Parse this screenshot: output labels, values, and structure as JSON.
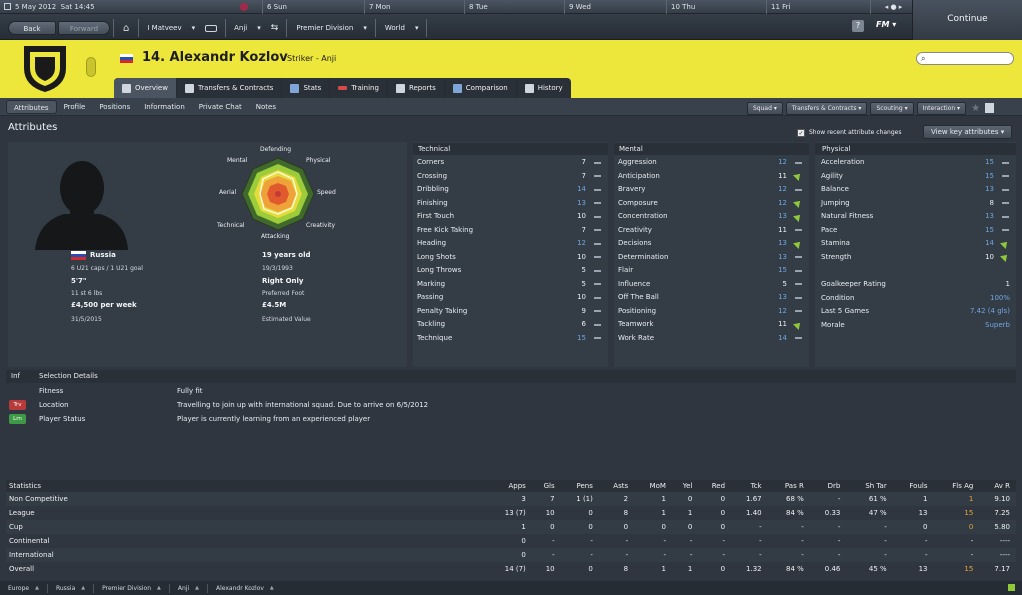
{
  "topbar": {
    "date": "5 May 2012",
    "time": "Sat 14:45",
    "calendar_days": [
      "6 Sun",
      "7 Mon",
      "8 Tue",
      "9 Wed",
      "10 Thu",
      "11 Fri"
    ],
    "back": "Back",
    "forward": "Forward",
    "manager": "I Matveev",
    "club": "Anji",
    "league": "Premier Division",
    "world": "World",
    "help": "?",
    "fm": "FM",
    "continue": "Continue"
  },
  "header": {
    "player_title": "14. Alexandr Kozlov",
    "player_sub": "Striker - Anji",
    "brand_color": "#ece73a",
    "tabs": [
      "Overview",
      "Transfers & Contracts",
      "Stats",
      "Training",
      "Reports",
      "Comparison",
      "History"
    ]
  },
  "subnav": {
    "links": [
      "Attributes",
      "Profile",
      "Positions",
      "Information",
      "Private Chat",
      "Notes"
    ],
    "dropdowns": [
      "Squad",
      "Transfers & Contracts",
      "Scouting",
      "Interaction"
    ]
  },
  "attributes": {
    "heading": "Attributes",
    "show_recent": "Show recent attribute changes",
    "view_key": "View key attributes"
  },
  "profile": {
    "nation": "Russia",
    "caps": "6 U21 caps / 1 U21 goal",
    "height": "5'7\"",
    "weight": "11 st 6 lbs",
    "wage": "£4,500 per week",
    "contract": "31/5/2015",
    "age": "19 years old",
    "dob": "19/3/1993",
    "foot": "Right Only",
    "foot_label": "Preferred Foot",
    "value": "£4.5M",
    "value_label": "Estimated Value"
  },
  "radar": {
    "labels": [
      "Defending",
      "Physical",
      "Speed",
      "Creativity",
      "Attacking",
      "Technical",
      "Aerial",
      "Mental"
    ]
  },
  "technical": {
    "title": "Technical",
    "items": [
      {
        "name": "Corners",
        "val": "7",
        "trend": "dash",
        "hi": false
      },
      {
        "name": "Crossing",
        "val": "7",
        "trend": "dash",
        "hi": false
      },
      {
        "name": "Dribbling",
        "val": "14",
        "trend": "dash",
        "hi": true
      },
      {
        "name": "Finishing",
        "val": "13",
        "trend": "dash",
        "hi": true
      },
      {
        "name": "First Touch",
        "val": "10",
        "trend": "dash",
        "hi": false
      },
      {
        "name": "Free Kick Taking",
        "val": "7",
        "trend": "dash",
        "hi": false
      },
      {
        "name": "Heading",
        "val": "12",
        "trend": "dash",
        "hi": true
      },
      {
        "name": "Long Shots",
        "val": "10",
        "trend": "dash",
        "hi": false
      },
      {
        "name": "Long Throws",
        "val": "5",
        "trend": "dash",
        "hi": false
      },
      {
        "name": "Marking",
        "val": "5",
        "trend": "dash",
        "hi": false
      },
      {
        "name": "Passing",
        "val": "10",
        "trend": "dash",
        "hi": false
      },
      {
        "name": "Penalty Taking",
        "val": "9",
        "trend": "dash",
        "hi": false
      },
      {
        "name": "Tackling",
        "val": "6",
        "trend": "dash",
        "hi": false
      },
      {
        "name": "Technique",
        "val": "15",
        "trend": "dash",
        "hi": true
      }
    ]
  },
  "mental": {
    "title": "Mental",
    "items": [
      {
        "name": "Aggression",
        "val": "12",
        "trend": "dash",
        "hi": true
      },
      {
        "name": "Anticipation",
        "val": "11",
        "trend": "up",
        "hi": false
      },
      {
        "name": "Bravery",
        "val": "12",
        "trend": "dash",
        "hi": true
      },
      {
        "name": "Composure",
        "val": "12",
        "trend": "up",
        "hi": true
      },
      {
        "name": "Concentration",
        "val": "13",
        "trend": "up",
        "hi": true
      },
      {
        "name": "Creativity",
        "val": "11",
        "trend": "dash",
        "hi": false
      },
      {
        "name": "Decisions",
        "val": "13",
        "trend": "up",
        "hi": true
      },
      {
        "name": "Determination",
        "val": "13",
        "trend": "dash",
        "hi": true
      },
      {
        "name": "Flair",
        "val": "15",
        "trend": "dash",
        "hi": true
      },
      {
        "name": "Influence",
        "val": "5",
        "trend": "dash",
        "hi": false
      },
      {
        "name": "Off The Ball",
        "val": "13",
        "trend": "dash",
        "hi": true
      },
      {
        "name": "Positioning",
        "val": "12",
        "trend": "dash",
        "hi": true
      },
      {
        "name": "Teamwork",
        "val": "11",
        "trend": "up",
        "hi": false
      },
      {
        "name": "Work Rate",
        "val": "14",
        "trend": "dash",
        "hi": true
      }
    ]
  },
  "physical": {
    "title": "Physical",
    "items": [
      {
        "name": "Acceleration",
        "val": "15",
        "trend": "dash",
        "hi": true
      },
      {
        "name": "Agility",
        "val": "15",
        "trend": "dash",
        "hi": true
      },
      {
        "name": "Balance",
        "val": "13",
        "trend": "dash",
        "hi": true
      },
      {
        "name": "Jumping",
        "val": "8",
        "trend": "dash",
        "hi": false
      },
      {
        "name": "Natural Fitness",
        "val": "13",
        "trend": "dash",
        "hi": true
      },
      {
        "name": "Pace",
        "val": "15",
        "trend": "dash",
        "hi": true
      },
      {
        "name": "Stamina",
        "val": "14",
        "trend": "up",
        "hi": true
      },
      {
        "name": "Strength",
        "val": "10",
        "trend": "up",
        "hi": false
      }
    ],
    "extras": [
      {
        "name": "Goalkeeper Rating",
        "val": "1"
      },
      {
        "name": "Condition",
        "val": "100%"
      },
      {
        "name": "Last 5 Games",
        "val": "7.42 (4 gls)"
      },
      {
        "name": "Morale",
        "val": "Superb"
      }
    ]
  },
  "selection": {
    "col1": "Inf",
    "col2": "Selection Details",
    "rows": [
      {
        "badge": "",
        "badge_color": "",
        "label": "Fitness",
        "detail": "Fully fit"
      },
      {
        "badge": "Trv",
        "badge_color": "#b83a3a",
        "label": "Location",
        "detail": "Travelling to join up with international squad. Due to arrive on 6/5/2012"
      },
      {
        "badge": "Lrn",
        "badge_color": "#3f9a48",
        "label": "Player Status",
        "detail": "Player is currently learning from an experienced player"
      }
    ]
  },
  "statistics": {
    "title": "Statistics",
    "columns": [
      "Apps",
      "Gls",
      "Pens",
      "Asts",
      "MoM",
      "Yel",
      "Red",
      "Tck",
      "Pas R",
      "Drb",
      "Sh Tar",
      "Fouls",
      "Fls Ag",
      "Av R"
    ],
    "rows": [
      {
        "name": "Non Competitive",
        "cells": [
          "3",
          "7",
          "1 (1)",
          "2",
          "1",
          "0",
          "0",
          "1.67",
          "68 %",
          "-",
          "61 %",
          "1",
          "1",
          "9.10"
        ]
      },
      {
        "name": "League",
        "cells": [
          "13 (7)",
          "10",
          "0",
          "8",
          "1",
          "1",
          "0",
          "1.40",
          "84 %",
          "0.33",
          "47 %",
          "13",
          "15",
          "7.25"
        ]
      },
      {
        "name": "Cup",
        "cells": [
          "1",
          "0",
          "0",
          "0",
          "0",
          "0",
          "0",
          "-",
          "-",
          "-",
          "-",
          "0",
          "0",
          "5.80"
        ]
      },
      {
        "name": "Continental",
        "cells": [
          "0",
          "-",
          "-",
          "-",
          "-",
          "-",
          "-",
          "-",
          "-",
          "-",
          "-",
          "-",
          "-",
          "----"
        ]
      },
      {
        "name": "International",
        "cells": [
          "0",
          "-",
          "-",
          "-",
          "-",
          "-",
          "-",
          "-",
          "-",
          "-",
          "-",
          "-",
          "-",
          "----"
        ]
      },
      {
        "name": "Overall",
        "cells": [
          "14 (7)",
          "10",
          "0",
          "8",
          "1",
          "1",
          "0",
          "1.32",
          "84 %",
          "0.46",
          "45 %",
          "13",
          "15",
          "7.17"
        ]
      }
    ]
  },
  "breadcrumb": [
    "Europe",
    "Russia",
    "Premier Division",
    "Anji",
    "Alexandr Kozlov"
  ],
  "colors": {
    "hi": "#6fa8e0",
    "orange": "#e8a53a",
    "trend_up": "#8fc93a"
  }
}
